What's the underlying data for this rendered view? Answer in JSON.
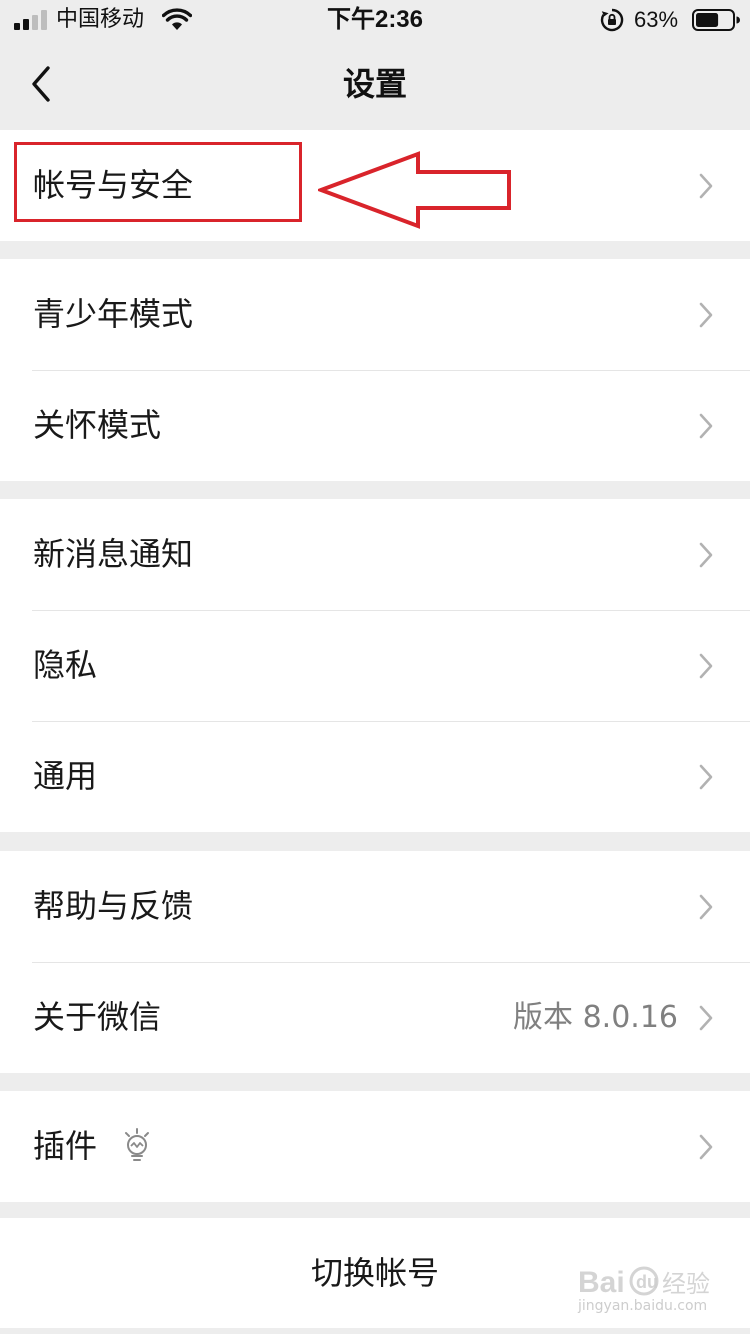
{
  "status_bar": {
    "carrier": "中国移动",
    "time": "下午2:36",
    "battery_percent": "63%",
    "battery_level": 0.63,
    "signal_icon": "signal-bars-icon",
    "wifi_icon": "wifi-icon",
    "lock_icon": "orientation-lock-icon"
  },
  "nav": {
    "title": "设置",
    "back_icon": "chevron-left-icon"
  },
  "groups": [
    {
      "items": [
        {
          "label": "帐号与安全"
        }
      ]
    },
    {
      "items": [
        {
          "label": "青少年模式"
        },
        {
          "label": "关怀模式"
        }
      ]
    },
    {
      "items": [
        {
          "label": "新消息通知"
        },
        {
          "label": "隐私"
        },
        {
          "label": "通用"
        }
      ]
    },
    {
      "items": [
        {
          "label": "帮助与反馈"
        },
        {
          "label": "关于微信",
          "value": "版本 8.0.16"
        }
      ]
    },
    {
      "items": [
        {
          "label": "插件",
          "icon": "plugin-bulb-icon"
        }
      ]
    }
  ],
  "switch_account": "切换帐号",
  "colors": {
    "background": "#ededed",
    "cell": "#ffffff",
    "annotation": "#d9242b",
    "secondary_text": "#808080"
  },
  "watermark": {
    "text": "jingyan.baidu.com"
  }
}
